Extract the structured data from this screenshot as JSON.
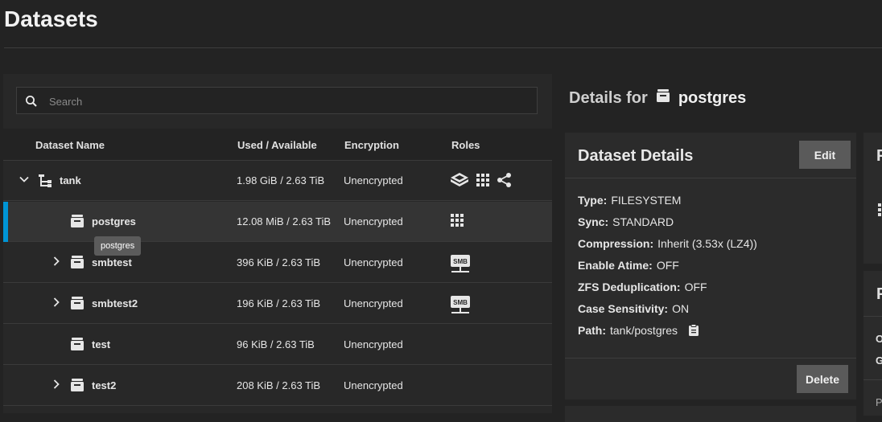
{
  "page": {
    "title": "Datasets"
  },
  "search": {
    "placeholder": "Search"
  },
  "tree": {
    "headers": {
      "name": "Dataset Name",
      "used": "Used / Available",
      "encryption": "Encryption",
      "roles": "Roles"
    },
    "rows": [
      {
        "name": "tank",
        "used": "1.98 GiB / 2.63 TiB",
        "encryption": "Unencrypted",
        "expand": "chevron-down",
        "icon": "pool-tree-icon",
        "roles": [
          "dataset-shared-icon",
          "apps-grid-icon",
          "share-icon"
        ]
      },
      {
        "name": "postgres",
        "used": "12.08 MiB / 2.63 TiB",
        "encryption": "Unencrypted",
        "expand": "",
        "icon": "dataset-icon",
        "roles": [
          "apps-grid-icon"
        ],
        "selected": true
      },
      {
        "name": "smbtest",
        "used": "396 KiB / 2.63 TiB",
        "encryption": "Unencrypted",
        "expand": "chevron-right",
        "icon": "dataset-icon",
        "roles": [
          "smb-share-icon"
        ]
      },
      {
        "name": "smbtest2",
        "used": "196 KiB / 2.63 TiB",
        "encryption": "Unencrypted",
        "expand": "chevron-right",
        "icon": "dataset-icon",
        "roles": [
          "smb-share-icon"
        ]
      },
      {
        "name": "test",
        "used": "96 KiB / 2.63 TiB",
        "encryption": "Unencrypted",
        "expand": "",
        "icon": "dataset-icon",
        "roles": []
      },
      {
        "name": "test2",
        "used": "208 KiB / 2.63 TiB",
        "encryption": "Unencrypted",
        "expand": "chevron-right",
        "icon": "dataset-icon",
        "roles": []
      }
    ],
    "tooltip": "postgres",
    "smb_label": "SMB"
  },
  "details": {
    "heading_prefix": "Details for",
    "dataset": "postgres",
    "card": {
      "title": "Dataset Details",
      "edit_label": "Edit",
      "delete_label": "Delete",
      "fields": [
        {
          "label": "Type:",
          "value": "FILESYSTEM"
        },
        {
          "label": "Sync:",
          "value": "STANDARD"
        },
        {
          "label": "Compression:",
          "value": "Inherit (3.53x (LZ4))"
        },
        {
          "label": "Enable Atime:",
          "value": "OFF"
        },
        {
          "label": "ZFS Deduplication:",
          "value": "OFF"
        },
        {
          "label": "Case Sensitivity:",
          "value": "ON"
        },
        {
          "label": "Path:",
          "value": "tank/postgres"
        }
      ]
    }
  },
  "side_cards": [
    {
      "title": "P",
      "lines": []
    },
    {
      "title": "P",
      "lines": [
        "O",
        "G"
      ],
      "footer": "P"
    }
  ],
  "colors": {
    "accent": "#0095d5",
    "background": "#232323",
    "panel": "#282828",
    "card": "#2b2b2b"
  }
}
